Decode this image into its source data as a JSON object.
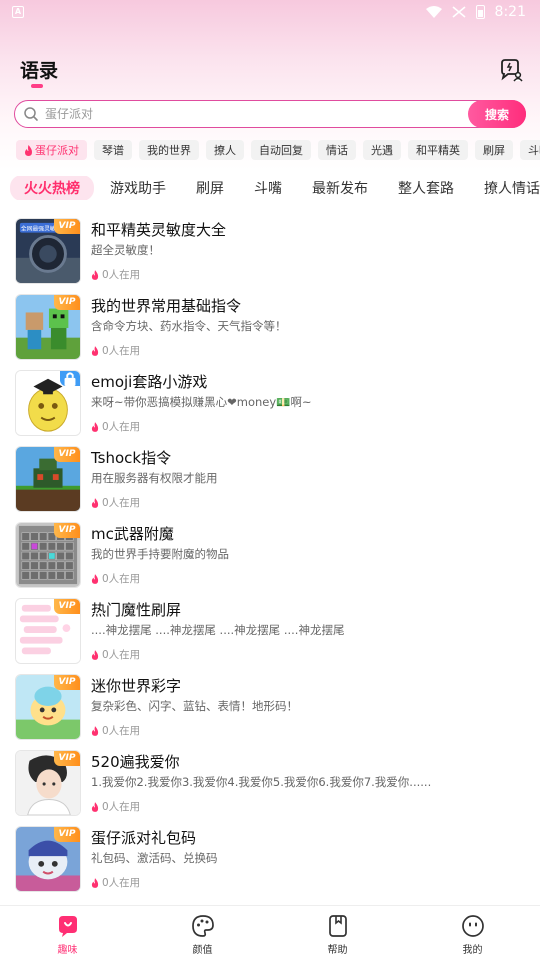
{
  "statusbar": {
    "time": "8:21",
    "left_icon": "A"
  },
  "header": {
    "title": "语录",
    "right_icon": "chat-user-icon"
  },
  "search": {
    "placeholder": "蛋仔派对",
    "button": "搜索"
  },
  "tags": [
    "蛋仔派对",
    "琴谱",
    "我的世界",
    "撩人",
    "自动回复",
    "情话",
    "光遇",
    "和平精英",
    "刷屏",
    "斗嘴"
  ],
  "categories": [
    "火火热榜",
    "游戏助手",
    "刷屏",
    "斗嘴",
    "最新发布",
    "整人套路",
    "撩人情话"
  ],
  "items": [
    {
      "title": "和平精英灵敏度大全",
      "desc": "超全灵敏度！",
      "users": "0人在用",
      "badge": "VIP",
      "thumb_label": "全网最强灵敏度"
    },
    {
      "title": "我的世界常用基础指令",
      "desc": "含命令方块、药水指令、天气指令等！",
      "users": "0人在用",
      "badge": "VIP"
    },
    {
      "title": "emoji套路小游戏",
      "desc": "来呀~带你恶搞模拟赚黑心❤money💵啊~",
      "users": "0人在用",
      "badge": "lock"
    },
    {
      "title": "Tshock指令",
      "desc": "用在服务器有权限才能用",
      "users": "0人在用",
      "badge": "VIP"
    },
    {
      "title": "mc武器附魔",
      "desc": "我的世界手持要附魔的物品",
      "users": "0人在用",
      "badge": "VIP"
    },
    {
      "title": "热门魔性刷屏",
      "desc": "....神龙摆尾      ....神龙摆尾      ....神龙摆尾      ....神龙摆尾",
      "users": "0人在用",
      "badge": "VIP"
    },
    {
      "title": "迷你世界彩字",
      "desc": "复杂彩色、闪字、蓝钻、表情！地形码！",
      "users": "0人在用",
      "badge": "VIP"
    },
    {
      "title": "520遍我爱你",
      "desc": "1.我爱你2.我爱你3.我爱你4.我爱你5.我爱你6.我爱你7.我爱你......",
      "users": "0人在用",
      "badge": "VIP"
    },
    {
      "title": "蛋仔派对礼包码",
      "desc": "礼包码、激活码、兑换码",
      "users": "0人在用",
      "badge": "VIP"
    }
  ],
  "nav": [
    {
      "label": "趣味",
      "icon": "chat-bubble-icon"
    },
    {
      "label": "颜值",
      "icon": "palette-icon"
    },
    {
      "label": "帮助",
      "icon": "book-icon"
    },
    {
      "label": "我的",
      "icon": "face-icon"
    }
  ],
  "colors": {
    "accent": "#ff2f74",
    "vip": "#ff9a2a",
    "lock": "#3f9cf5"
  }
}
